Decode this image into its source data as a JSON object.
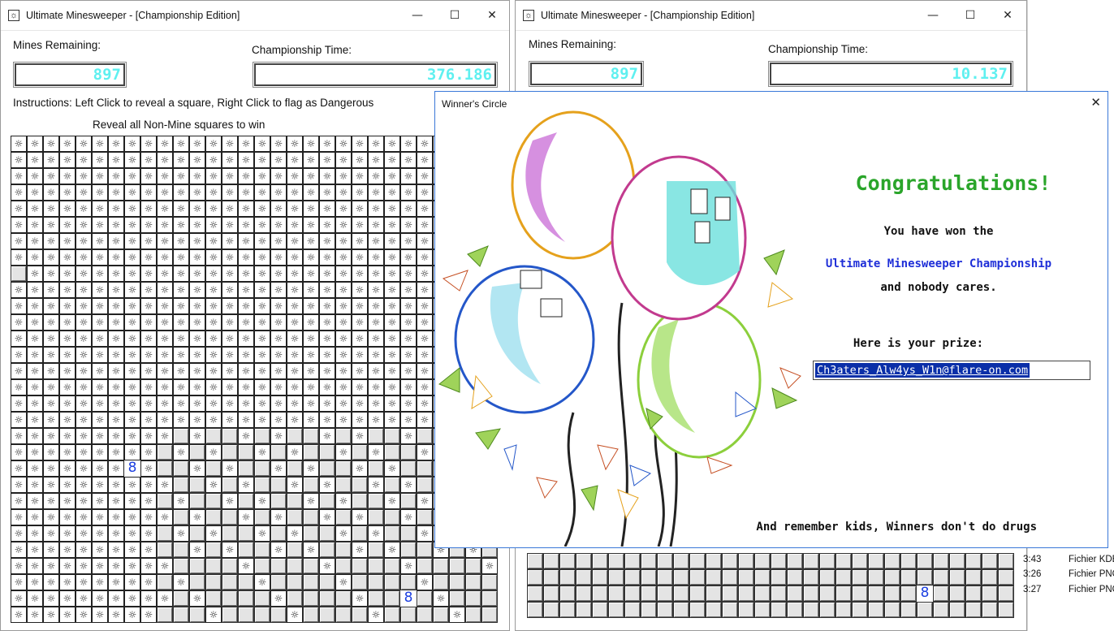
{
  "window_left": {
    "title": "Ultimate Minesweeper - [Championship Edition]",
    "app_icon": "mine-icon",
    "mines_label": "Mines Remaining:",
    "mines_value": "897",
    "time_label": "Championship Time:",
    "time_value": "376.186",
    "instructions": "Instructions: Left Click to reveal a square, Right Click to flag as Dangerous",
    "subtitle": "Reveal all Non-Mine squares to win",
    "number_cell": "8"
  },
  "window_right": {
    "title": "Ultimate Minesweeper - [Championship Edition]",
    "app_icon": "mine-icon",
    "mines_label": "Mines Remaining:",
    "mines_value": "897",
    "time_label": "Championship Time:",
    "time_value": "10.137",
    "number_cell": "8"
  },
  "controls": {
    "minimize": "—",
    "maximize": "☐",
    "close": "✕"
  },
  "dialog": {
    "title": "Winner's Circle",
    "close": "✕",
    "heading": "Congratulations!",
    "line1": "You have won the",
    "line2": "Ultimate Minesweeper Championship",
    "line3": "and nobody cares.",
    "prize_label": "Here is your prize:",
    "prize_value": "Ch3aters_Alw4ys_W1n@flare-on.com",
    "footer": "And remember kids, Winners don't do drugs"
  },
  "explorer": {
    "rows": [
      {
        "time": "3:43",
        "type": "Fichier KDE"
      },
      {
        "time": "3:26",
        "type": "Fichier PNG"
      },
      {
        "time": "3:27",
        "type": "Fichier PNG"
      }
    ]
  },
  "colors": {
    "lcd": "#5ff0f0",
    "heading": "#2aa52a",
    "link": "#1f2fd8",
    "number": "#1c3fe0",
    "prize_bg": "#0a2fa8"
  }
}
